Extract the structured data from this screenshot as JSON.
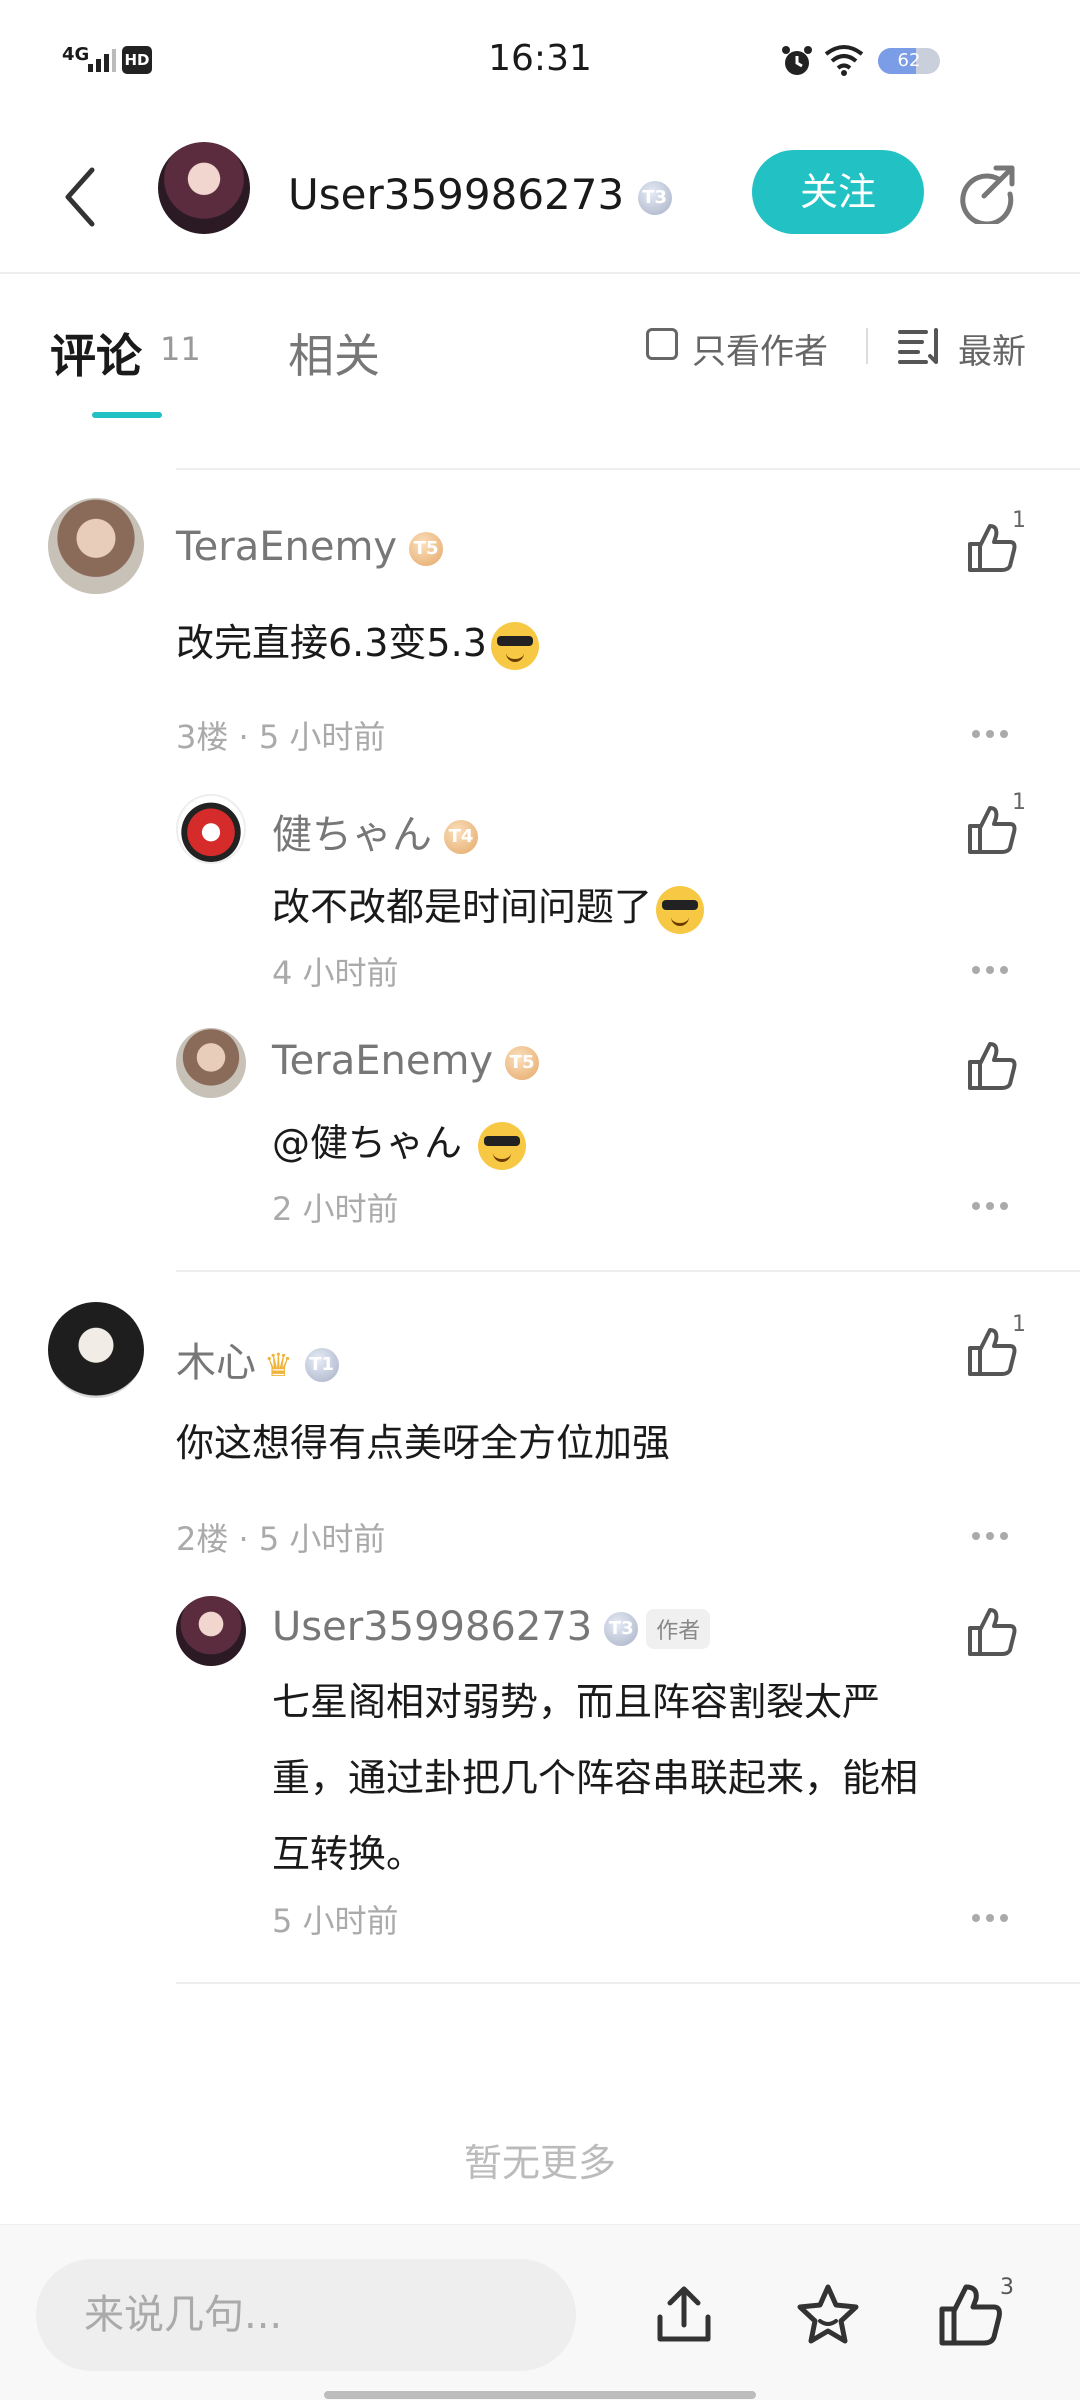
{
  "status_bar": {
    "time": "16:31",
    "network": "4G",
    "hd": "HD",
    "battery": "62",
    "battery_level": 0.62
  },
  "header": {
    "username": "User359986273",
    "level": "T3",
    "follow_label": "关注"
  },
  "tabs": {
    "comments_label": "评论",
    "comments_count": "11",
    "related_label": "相关",
    "only_author_label": "只看作者",
    "sort_label": "最新"
  },
  "comments": [
    {
      "user": "TeraEnemy",
      "level": "T5",
      "text": "改完直接6.3变5.3",
      "floor": "3楼",
      "time": "5 小时前",
      "likes": "1",
      "replies": [
        {
          "user": "健ちゃん",
          "level": "T4",
          "text": "改不改都是时间问题了",
          "time": "4 小时前",
          "likes": "1"
        },
        {
          "user": "TeraEnemy",
          "level": "T5",
          "text": "@健ちゃん ",
          "time": "2 小时前",
          "likes": ""
        }
      ]
    },
    {
      "user": "木心",
      "level": "T1",
      "text": "你这想得有点美呀全方位加强",
      "floor": "2楼",
      "time": "5 小时前",
      "likes": "1",
      "replies": [
        {
          "user": "User359986273",
          "level": "T3",
          "author_tag": "作者",
          "text_lines": [
            "七星阁相对弱势，而且阵容割裂太严",
            "重，通过卦把几个阵容串联起来，能相",
            "互转换。"
          ],
          "time": "5 小时前",
          "likes": ""
        }
      ]
    }
  ],
  "footer": {
    "no_more": "暂无更多",
    "input_placeholder": "来说几句...",
    "like_count": "3"
  },
  "icons": [
    "back-icon",
    "share-icon",
    "sort-icon",
    "like-icon",
    "more-icon",
    "upload-icon",
    "star-icon",
    "crown-icon",
    "emoji-icon"
  ],
  "colors": {
    "accent": "#22c2c4"
  }
}
